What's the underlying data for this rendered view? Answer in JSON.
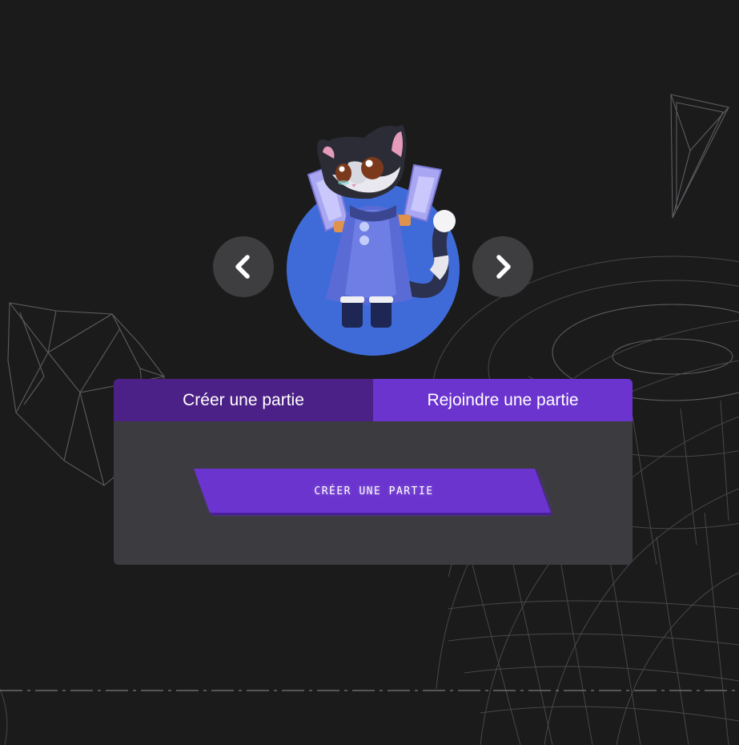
{
  "carousel": {
    "prev_icon": "chevron-left-icon",
    "next_icon": "chevron-right-icon",
    "avatar_description_icon": "cat-knight-avatar-icon"
  },
  "tabs": [
    {
      "label": "Créer une partie",
      "active": true
    },
    {
      "label": "Rejoindre une partie",
      "active": false
    }
  ],
  "create_panel": {
    "button_label": "CRÉER UNE PARTIE"
  },
  "colors": {
    "background": "#1b1b1c",
    "panel": "#3c3b3f",
    "tab_active": "#4c2187",
    "tab_inactive": "#6b34cf",
    "button": "#6b34cf",
    "avatar_circle": "#3f6bd9",
    "arrow_button": "#3e3e40"
  }
}
